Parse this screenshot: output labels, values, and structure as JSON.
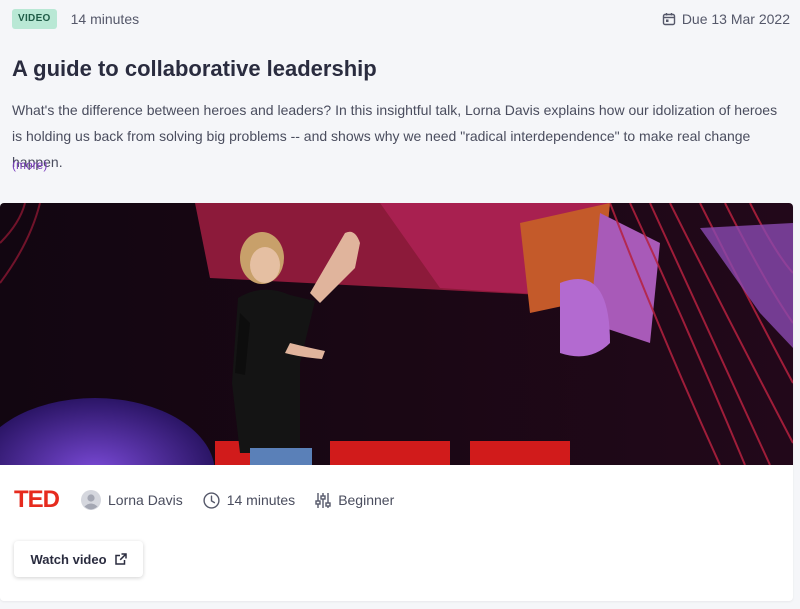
{
  "header": {
    "badge": "VIDEO",
    "duration": "14 minutes",
    "due": "Due 13 Mar 2022"
  },
  "title": "A guide to collaborative leadership",
  "description": "What's the difference between heroes and leaders? In this insightful talk, Lorna Davis explains how our idolization of heroes is holding us back from solving big problems -- and shows why we need \"radical interdependence\" to make real change happen.",
  "more_link": "(more)",
  "card": {
    "provider_logo": "TED",
    "speaker": "Lorna Davis",
    "duration": "14 minutes",
    "level": "Beginner",
    "watch_label": "Watch video"
  },
  "icons": {
    "calendar": "calendar-icon",
    "avatar": "avatar-icon",
    "clock": "clock-icon",
    "level": "sliders-icon",
    "external": "external-link-icon"
  },
  "colors": {
    "badge_bg": "#b9e8d5",
    "link": "#7a3dbf",
    "ted_red": "#e62b1e",
    "title": "#2a2c3f"
  }
}
